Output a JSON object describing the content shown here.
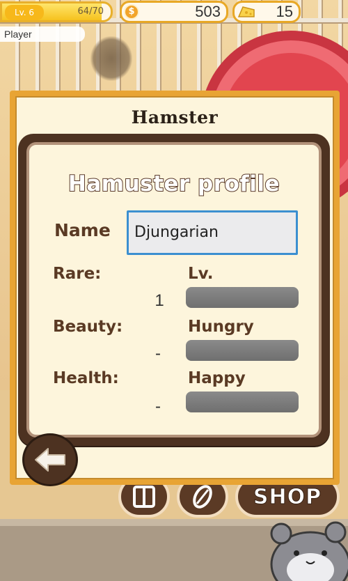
{
  "hud": {
    "level_label": "Lv. 6",
    "xp_text": "64/70",
    "xp_progress": 0.914,
    "player_name": "Player",
    "coins": "503",
    "cheese": "15",
    "coin_icon_glyph": "$"
  },
  "dialog": {
    "title": "Hamster",
    "profile_heading": "Hamuster profile",
    "name_label": "Name",
    "name_value": "Djungarian",
    "stats": {
      "rare_label": "Rare:",
      "rare_value": "1",
      "beauty_label": "Beauty:",
      "beauty_value": "-",
      "health_label": "Health:",
      "health_value": "-",
      "lv_label": "Lv.",
      "lv_progress": 0,
      "hungry_label": "Hungry",
      "hungry_progress": 0,
      "happy_label": "Happy",
      "happy_progress": 0
    }
  },
  "menu": {
    "shop_label": "SHOP"
  },
  "icons": {
    "back": "back-arrow-icon",
    "cage": "cage-icon",
    "food": "seed-icon",
    "coin": "coin-icon",
    "cheese": "cheese-icon"
  },
  "colors": {
    "dialog_border": "#e8a434",
    "panel_bg": "#fdf5dc",
    "frame_brown": "#4d3221",
    "label_brown": "#5a3a24",
    "input_border": "#3b8fd0",
    "xp_fill": "#f6c21e"
  }
}
